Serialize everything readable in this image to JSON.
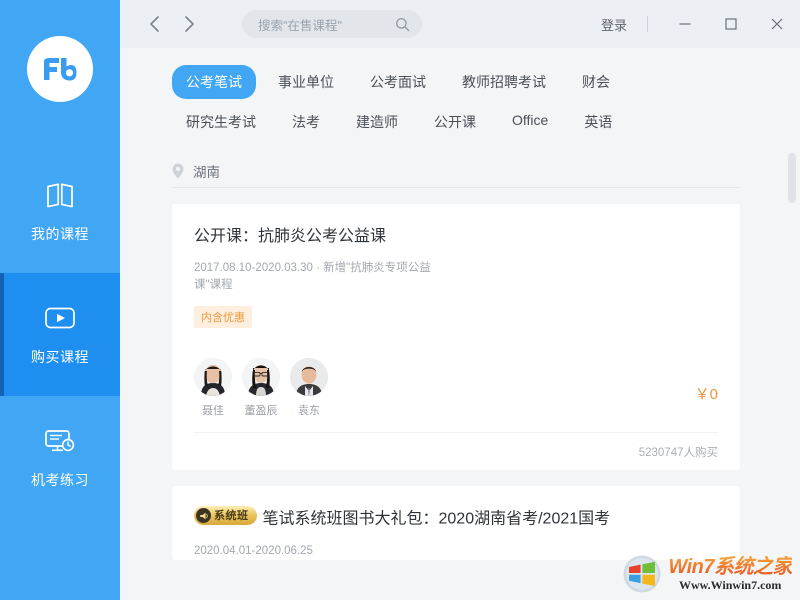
{
  "app": {
    "brand_color": "#41a7f5",
    "active_nav_color": "#1e8ef1",
    "logo_text": "Fb"
  },
  "sidebar": {
    "items": [
      {
        "label": "我的课程",
        "icon": "book-icon",
        "active": false
      },
      {
        "label": "购买课程",
        "icon": "play-video-icon",
        "active": true
      },
      {
        "label": "机考练习",
        "icon": "monitor-clock-icon",
        "active": false
      }
    ]
  },
  "titlebar": {
    "back_icon": "chevron-left-icon",
    "forward_icon": "chevron-right-icon",
    "search": {
      "placeholder": "搜索\"在售课程\"",
      "value": "",
      "icon": "search-icon"
    },
    "login_label": "登录",
    "window_controls": {
      "minimize": "minimize-icon",
      "maximize": "maximize-icon",
      "close": "close-icon"
    }
  },
  "tabs": [
    {
      "label": "公考笔试",
      "active": true
    },
    {
      "label": "事业单位",
      "active": false
    },
    {
      "label": "公考面试",
      "active": false
    },
    {
      "label": "教师招聘考试",
      "active": false
    },
    {
      "label": "财会",
      "active": false
    },
    {
      "label": "研究生考试",
      "active": false
    },
    {
      "label": "法考",
      "active": false
    },
    {
      "label": "建造师",
      "active": false
    },
    {
      "label": "公开课",
      "active": false
    },
    {
      "label": "Office",
      "active": false
    },
    {
      "label": "英语",
      "active": false
    }
  ],
  "location": {
    "icon": "location-pin-icon",
    "value": "湖南"
  },
  "cards": [
    {
      "title": "公开课：抗肺炎公考公益课",
      "subtitle": "2017.08.10-2020.03.30 · 新增\"抗肺炎专项公益课\"课程",
      "promo_tag": "内含优惠",
      "teachers": [
        {
          "name": "聂佳"
        },
        {
          "name": "董盈辰"
        },
        {
          "name": "袁东"
        }
      ],
      "price": "￥0",
      "buy_count": "5230747人购买"
    },
    {
      "badge": "系统班",
      "title": "笔试系统班图书大礼包：2020湖南省考/2021国考",
      "subtitle": "2020.04.01-2020.06.25"
    }
  ],
  "scrollbar": {
    "name": "vertical-scrollbar"
  },
  "watermark": {
    "title": "Win7系统之家",
    "url": "Www.Winwin7.com"
  }
}
